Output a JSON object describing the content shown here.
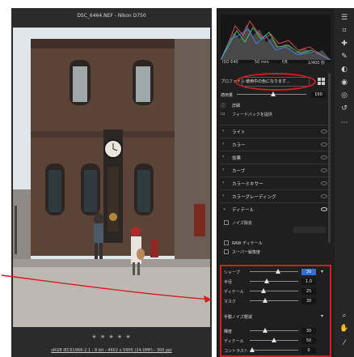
{
  "preview": {
    "title": "DSC_6464.NEF - Nikon D750",
    "rating": "★ ★ ★ ★ ★",
    "caption": "sRGB IEC61966-2.1 - 8 bit - 4602 x 5905 (24.0MP) - 300 ppi"
  },
  "histogram": {
    "iso": "ISO 640",
    "focal": "50 mm",
    "aperture": "f/8",
    "shutter": "1/400 秒"
  },
  "profile": {
    "label": "プロファイル",
    "value": "使用中の色になります...",
    "amount_label": "適用量",
    "amount_value": "100"
  },
  "links": {
    "details": "詳細",
    "feedback": "フィードバックを提供"
  },
  "sections": [
    {
      "name": "ライト",
      "expanded": false
    },
    {
      "name": "カラー",
      "expanded": false
    },
    {
      "name": "効果",
      "expanded": false
    },
    {
      "name": "カーブ",
      "expanded": false
    },
    {
      "name": "カラーミキサー",
      "expanded": false
    },
    {
      "name": "カラーグレーディング",
      "expanded": false
    },
    {
      "name": "ディテール",
      "expanded": true
    }
  ],
  "detail": {
    "noise_label": "ノイズ除去",
    "raw_detail": "RAW ディテール",
    "super_resolution": "スーパー解像度",
    "sharpen": [
      {
        "label": "シャープ",
        "value": "30",
        "fill": 0.6,
        "highlight": true
      },
      {
        "label": "半径",
        "value": "1.0",
        "fill": 0.33
      },
      {
        "label": "ディテール",
        "value": "25",
        "fill": 0.25
      },
      {
        "label": "マスク",
        "value": "30",
        "fill": 0.3
      }
    ],
    "manual_nr_label": "手動ノイズ軽減",
    "noise_reduction": [
      {
        "label": "輝度",
        "value": "30",
        "fill": 0.3
      },
      {
        "label": "ディテール",
        "value": "50",
        "fill": 0.5
      },
      {
        "label": "コントラスト",
        "value": "0",
        "fill": 0.0
      }
    ]
  },
  "colors": {
    "accent": "#d21f1f",
    "panel": "#1f1f1f",
    "highlight": "#2f6fd6"
  }
}
